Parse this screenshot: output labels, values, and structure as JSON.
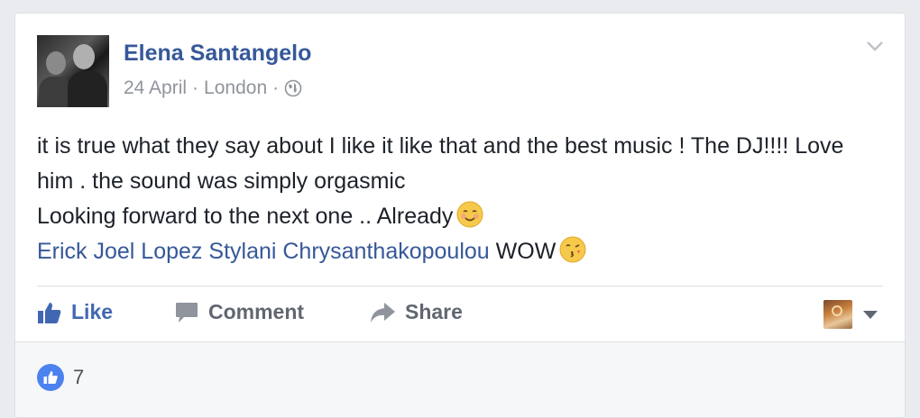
{
  "post": {
    "author": "Elena Santangelo",
    "date": "24 April",
    "separator": "·",
    "location": "London",
    "privacy_icon": "globe-icon",
    "text_lines": [
      "it is true what they say about I like it like that and the best music ! The DJ!!!! Love him . the sound was simply orgasmic",
      "Looking forward to the next one .. Already"
    ],
    "tagged": [
      "Erick Joel Lopez",
      "Stylani Chrysanthakopoulou"
    ],
    "tail_text": "WOW"
  },
  "actions": {
    "like_label": "Like",
    "comment_label": "Comment",
    "share_label": "Share"
  },
  "reactions": {
    "like_count": "7"
  },
  "colors": {
    "link": "#365899",
    "like_blue": "#4267b2",
    "muted": "#90949c",
    "action_gray": "#606770"
  }
}
